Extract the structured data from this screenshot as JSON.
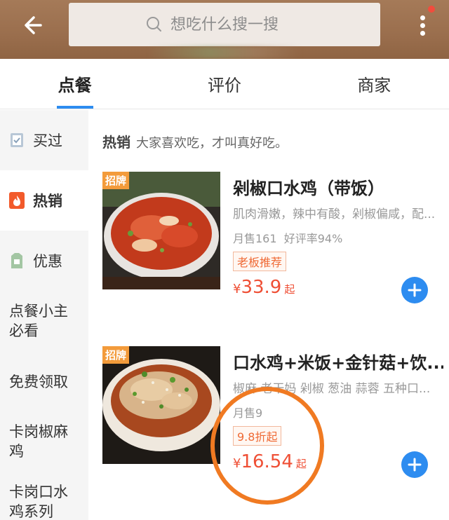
{
  "header": {
    "search_placeholder": "想吃什么搜一搜"
  },
  "tabs": [
    {
      "label": "点餐",
      "active": true
    },
    {
      "label": "评价",
      "active": false
    },
    {
      "label": "商家",
      "active": false
    }
  ],
  "sidebar": {
    "items": [
      {
        "label": "买过",
        "icon": "bought-icon"
      },
      {
        "label": "热销",
        "icon": "flame-icon",
        "active": true
      },
      {
        "label": "优惠",
        "icon": "discount-icon"
      },
      {
        "label": "点餐小主必看"
      },
      {
        "label": "免费领取"
      },
      {
        "label": "卡岗椒麻鸡"
      },
      {
        "label": "卡岗口水鸡系列"
      }
    ]
  },
  "section": {
    "title": "热销",
    "subtitle": "大家喜欢吃，才叫真好吃。"
  },
  "products": [
    {
      "badge": "招牌",
      "title": "剁椒口水鸡（带饭）",
      "desc": "肌肉滑嫩，辣中有酸，剁椒偏咸，配...",
      "sales": "月售161",
      "rating": "好评率94%",
      "tag": "老板推荐",
      "currency": "¥",
      "price": "33.9",
      "price_suffix": "起"
    },
    {
      "badge": "招牌",
      "title": "口水鸡+米饭+金针菇+饮...",
      "desc": "椒麻 老干妈 剁椒 葱油 蒜蓉 五种口...",
      "sales": "月售9",
      "tag": "9.8折起",
      "currency": "¥",
      "price": "16.54",
      "price_suffix": "起"
    }
  ],
  "colors": {
    "header_bg": "#9a6e4d",
    "accent_blue": "#2d8cf0",
    "price_red": "#ef4f35",
    "tag_orange": "#ef6a35",
    "highlight_circle": "#f07a22"
  }
}
